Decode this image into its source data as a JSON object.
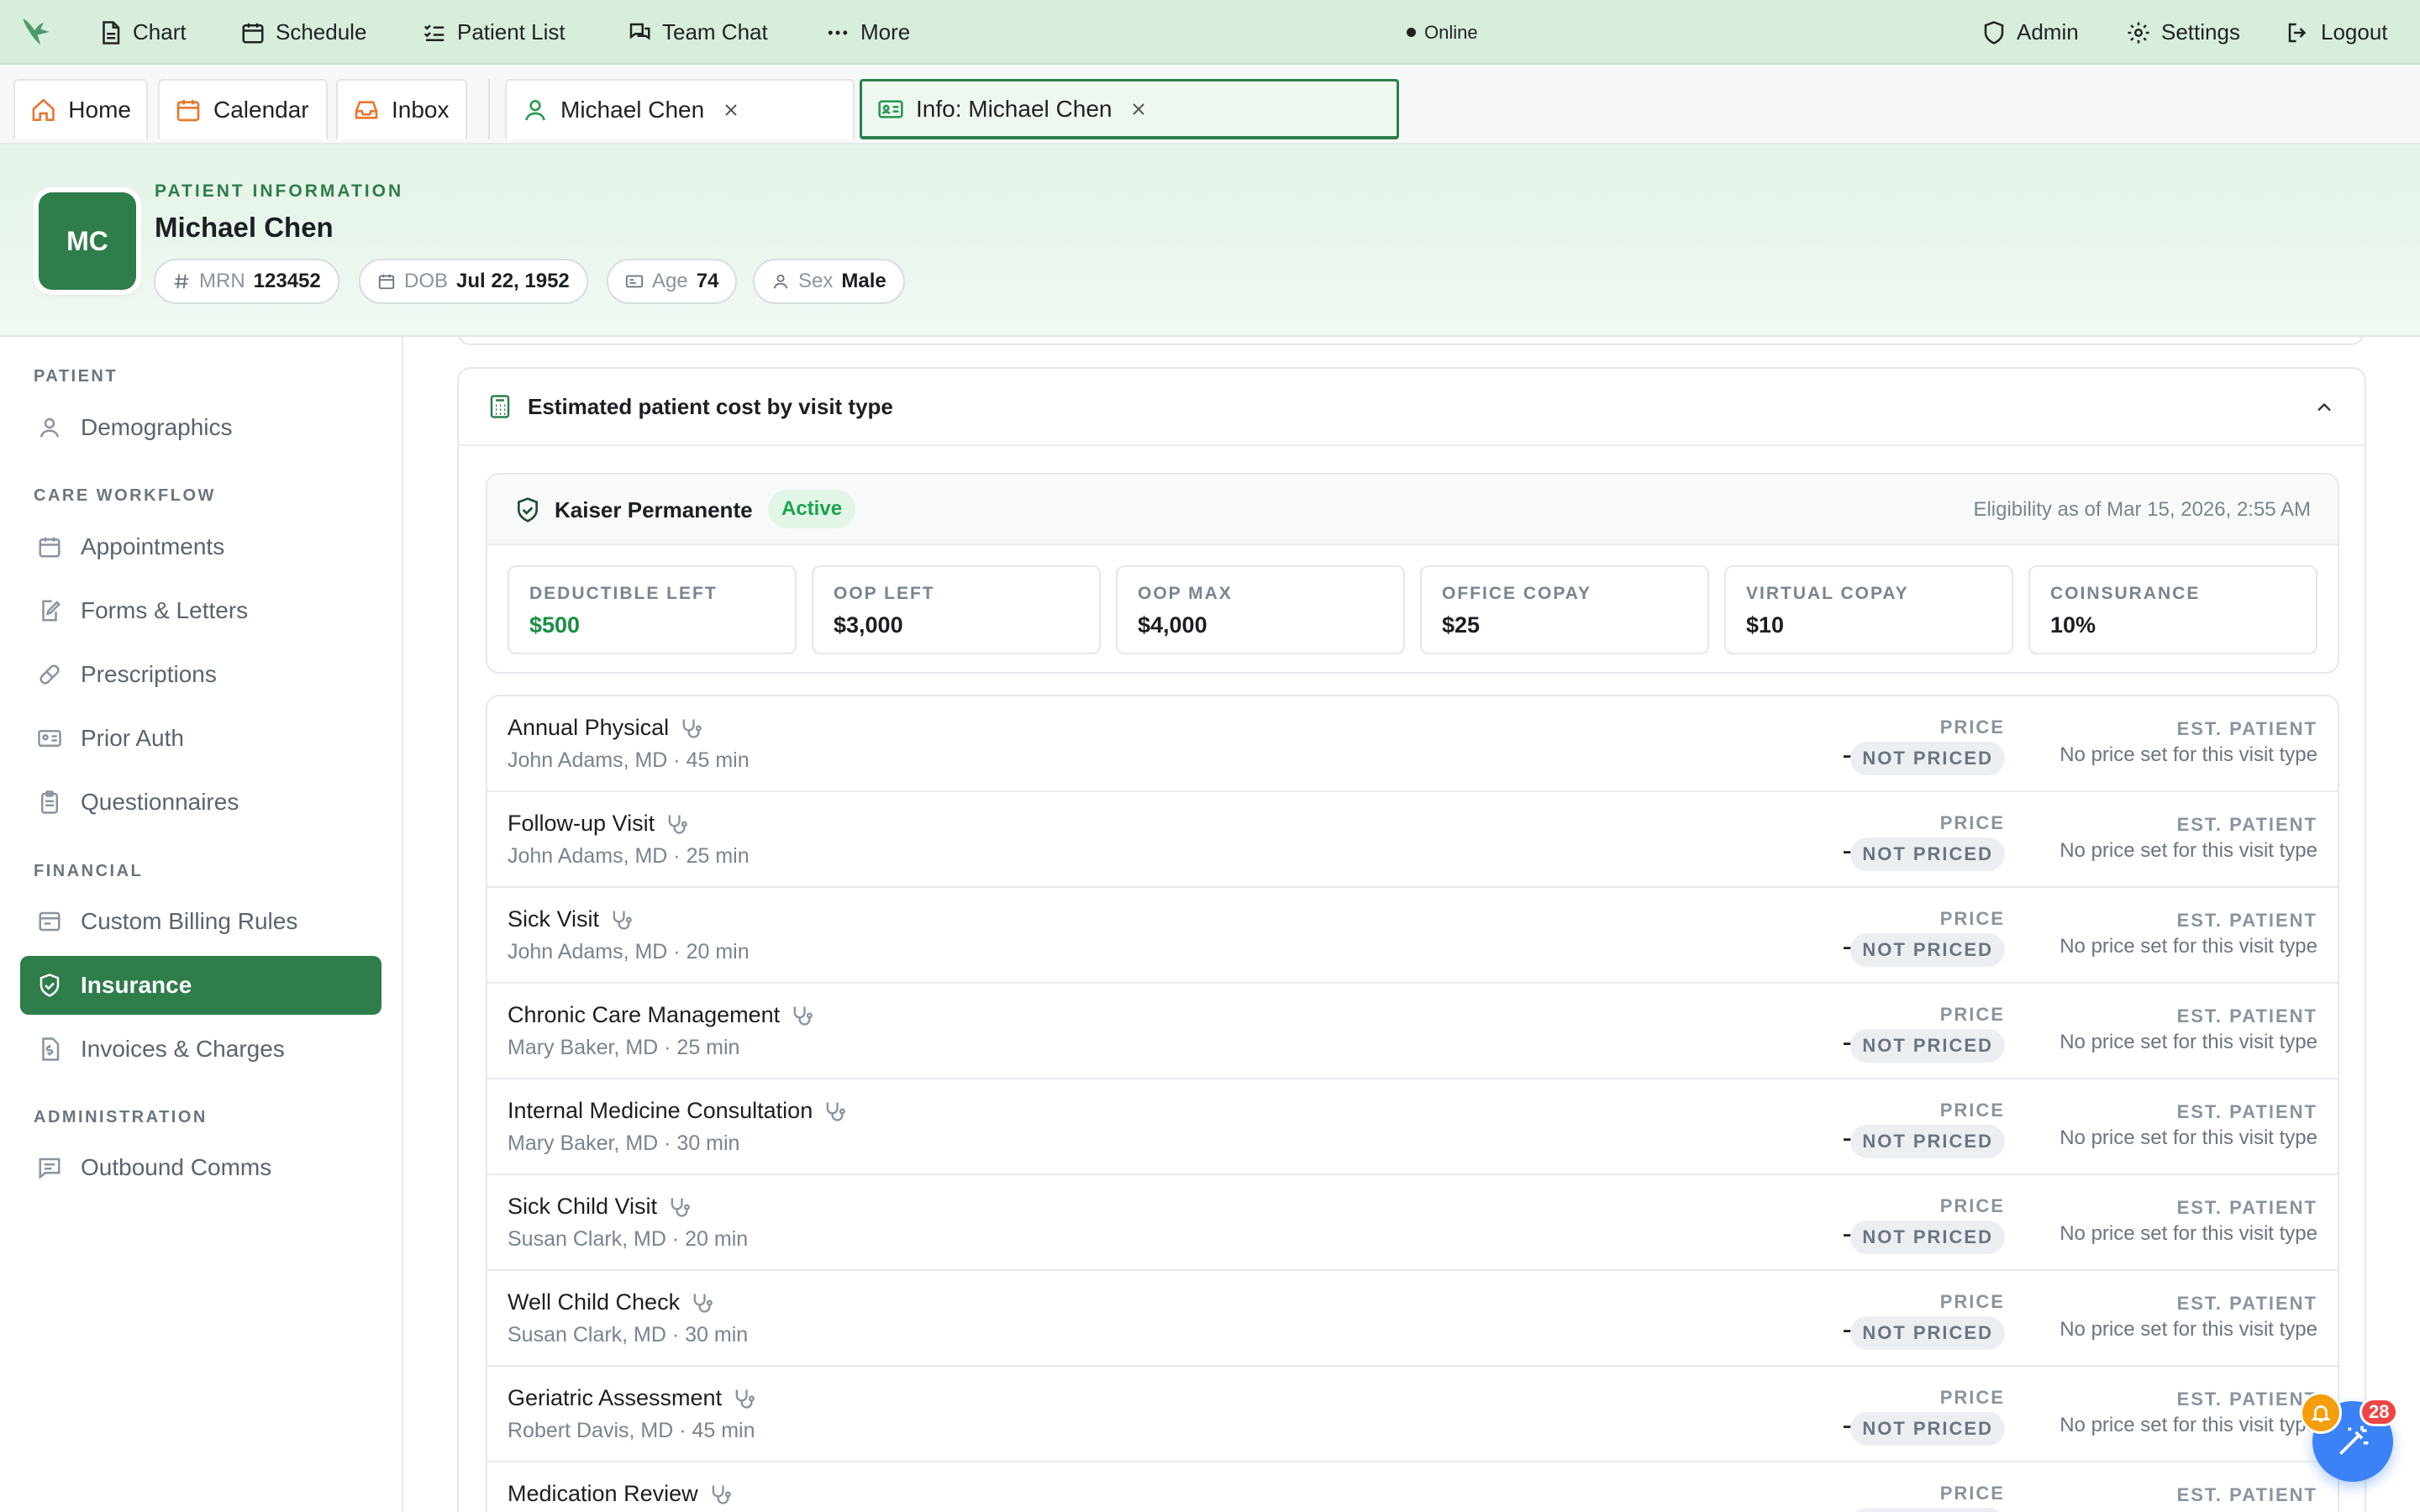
{
  "topnav": {
    "items": [
      {
        "label": "Chart",
        "icon": "document-icon"
      },
      {
        "label": "Schedule",
        "icon": "calendar-icon"
      },
      {
        "label": "Patient List",
        "icon": "list-check-icon"
      },
      {
        "label": "Team Chat",
        "icon": "chat-icon"
      },
      {
        "label": "More",
        "icon": "dots-icon"
      }
    ],
    "status": "Online",
    "right": [
      {
        "label": "Admin",
        "icon": "shield-icon"
      },
      {
        "label": "Settings",
        "icon": "gear-icon"
      },
      {
        "label": "Logout",
        "icon": "logout-icon"
      }
    ]
  },
  "tabs": {
    "fixed": [
      {
        "label": "Home",
        "icon": "home-icon"
      },
      {
        "label": "Calendar",
        "icon": "calendar-icon"
      },
      {
        "label": "Inbox",
        "icon": "inbox-icon"
      }
    ],
    "open": [
      {
        "label": "Michael Chen",
        "icon": "user-icon"
      },
      {
        "label": "Info: Michael Chen",
        "icon": "id-card-icon",
        "active": true
      }
    ]
  },
  "patient": {
    "section_label": "PATIENT INFORMATION",
    "initials": "MC",
    "name": "Michael Chen",
    "chips": [
      {
        "key": "MRN",
        "value": "123452",
        "icon": "hash-icon"
      },
      {
        "key": "DOB",
        "value": "Jul 22, 1952",
        "icon": "calendar-icon"
      },
      {
        "key": "Age",
        "value": "74",
        "icon": "id-card-icon"
      },
      {
        "key": "Sex",
        "value": "Male",
        "icon": "user-icon"
      }
    ]
  },
  "sidebar": {
    "sections": [
      {
        "title": "PATIENT",
        "items": [
          {
            "label": "Demographics",
            "icon": "user-icon"
          }
        ]
      },
      {
        "title": "CARE WORKFLOW",
        "items": [
          {
            "label": "Appointments",
            "icon": "calendar-icon"
          },
          {
            "label": "Forms & Letters",
            "icon": "file-edit-icon"
          },
          {
            "label": "Prescriptions",
            "icon": "pill-icon"
          },
          {
            "label": "Prior Auth",
            "icon": "id-card-icon"
          },
          {
            "label": "Questionnaires",
            "icon": "clipboard-icon"
          }
        ]
      },
      {
        "title": "FINANCIAL",
        "items": [
          {
            "label": "Custom Billing Rules",
            "icon": "billing-icon"
          },
          {
            "label": "Insurance",
            "icon": "shield-check-icon",
            "active": true
          },
          {
            "label": "Invoices & Charges",
            "icon": "dollar-file-icon"
          }
        ]
      },
      {
        "title": "ADMINISTRATION",
        "items": [
          {
            "label": "Outbound Comms",
            "icon": "message-icon"
          }
        ]
      }
    ]
  },
  "cost_card": {
    "title": "Estimated patient cost by visit type",
    "insurer": "Kaiser Permanente",
    "status": "Active",
    "eligibility": "Eligibility as of Mar 15, 2026, 2:55 AM",
    "stats": [
      {
        "label": "DEDUCTIBLE LEFT",
        "value": "$500",
        "highlight": true
      },
      {
        "label": "OOP LEFT",
        "value": "$3,000"
      },
      {
        "label": "OOP MAX",
        "value": "$4,000"
      },
      {
        "label": "OFFICE COPAY",
        "value": "$25"
      },
      {
        "label": "VIRTUAL COPAY",
        "value": "$10"
      },
      {
        "label": "COINSURANCE",
        "value": "10%"
      }
    ],
    "price_label": "PRICE",
    "price_value": "—",
    "price_badge": "NOT PRICED",
    "est_label": "EST. PATIENT",
    "est_note": "No price set for this visit type",
    "visits": [
      {
        "name": "Annual Physical",
        "provider": "John Adams, MD · 45 min"
      },
      {
        "name": "Follow-up Visit",
        "provider": "John Adams, MD · 25 min"
      },
      {
        "name": "Sick Visit",
        "provider": "John Adams, MD · 20 min"
      },
      {
        "name": "Chronic Care Management",
        "provider": "Mary Baker, MD · 25 min"
      },
      {
        "name": "Internal Medicine Consultation",
        "provider": "Mary Baker, MD · 30 min"
      },
      {
        "name": "Sick Child Visit",
        "provider": "Susan Clark, MD · 20 min"
      },
      {
        "name": "Well Child Check",
        "provider": "Susan Clark, MD · 30 min"
      },
      {
        "name": "Geriatric Assessment",
        "provider": "Robert Davis, MD · 45 min"
      },
      {
        "name": "Medication Review",
        "provider": ""
      }
    ]
  },
  "assistant": {
    "badge_count": "28"
  },
  "colors": {
    "brand": "#2e7d4a",
    "nav_bg": "#d8eedd",
    "active_green": "#1aa44d",
    "fab_blue": "#3b82f6",
    "alert_red": "#ef4444"
  }
}
